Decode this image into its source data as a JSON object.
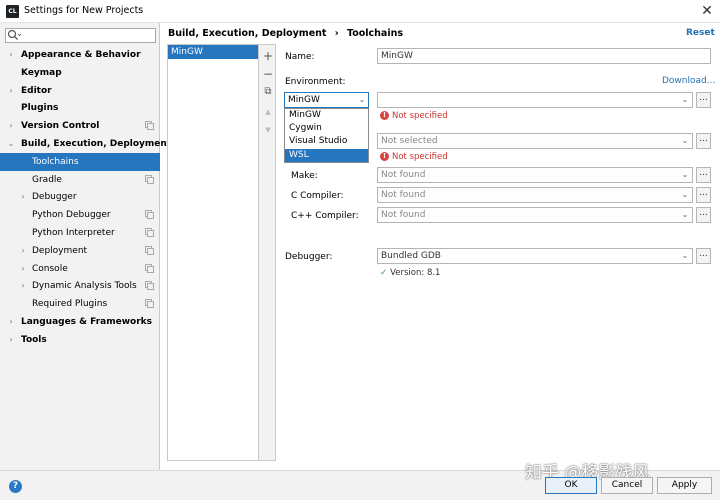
{
  "window": {
    "title": "Settings for New Projects",
    "app_icon_text": "CL",
    "close_glyph": "✕"
  },
  "search": {
    "placeholder": "",
    "icon": "search-icon"
  },
  "sidebar": {
    "items": [
      {
        "label": "Appearance & Behavior",
        "arrow": "›",
        "bold": true
      },
      {
        "label": "Keymap",
        "arrow": "",
        "bold": true
      },
      {
        "label": "Editor",
        "arrow": "›",
        "bold": true
      },
      {
        "label": "Plugins",
        "arrow": "",
        "bold": true
      },
      {
        "label": "Version Control",
        "arrow": "›",
        "bold": true,
        "copy": true
      },
      {
        "label": "Build, Execution, Deployment",
        "arrow": "⌄",
        "bold": true
      },
      {
        "label": "Toolchains",
        "arrow": "",
        "selected": true
      },
      {
        "label": "Gradle",
        "arrow": "",
        "copy": true
      },
      {
        "label": "Debugger",
        "arrow": "›",
        "copy": false
      },
      {
        "label": "Python Debugger",
        "arrow": "",
        "copy": true
      },
      {
        "label": "Python Interpreter",
        "arrow": "",
        "copy": true
      },
      {
        "label": "Deployment",
        "arrow": "›",
        "copy": true
      },
      {
        "label": "Console",
        "arrow": "›",
        "copy": true
      },
      {
        "label": "Dynamic Analysis Tools",
        "arrow": "›",
        "copy": true
      },
      {
        "label": "Required Plugins",
        "arrow": "",
        "copy": true
      },
      {
        "label": "Languages & Frameworks",
        "arrow": "›",
        "bold": true
      },
      {
        "label": "Tools",
        "arrow": "›",
        "bold": true
      }
    ]
  },
  "header": {
    "breadcrumb_parent": "Build, Execution, Deployment",
    "breadcrumb_sep": "›",
    "breadcrumb_current": "Toolchains",
    "reset_label": "Reset"
  },
  "toolchains": {
    "items": [
      "MinGW"
    ],
    "add": "+",
    "remove": "−",
    "copy": "⧉",
    "up": "▲",
    "down": "▼"
  },
  "form": {
    "name_label": "Name:",
    "name_value": "MinGW",
    "environment_label": "Environment:",
    "download_label": "Download...",
    "environment_value": "MinGW",
    "environment_options": [
      "MinGW",
      "Cygwin",
      "Visual Studio",
      "WSL"
    ],
    "environment_highlighted": "WSL",
    "env_path_value": "",
    "not_specified_1": "Not specified",
    "cmake_value": "Not selected",
    "not_specified_2": "Not specified",
    "make_label": "Make:",
    "make_value": "Not found",
    "c_compiler_label": "C Compiler:",
    "c_compiler_value": "Not found",
    "cpp_compiler_label": "C++ Compiler:",
    "cpp_compiler_value": "Not found",
    "debugger_label": "Debugger:",
    "debugger_value": "Bundled GDB",
    "version_text": "Version: 8.1",
    "dots": "...",
    "arrow": "⌄"
  },
  "footer": {
    "help": "?",
    "ok_label": "OK",
    "cancel_label": "Cancel",
    "apply_label": "Apply",
    "watermark": "知乎 @移影残风"
  },
  "colors": {
    "accent": "#2675bf",
    "link": "#2470b3",
    "error": "#c8342f"
  }
}
